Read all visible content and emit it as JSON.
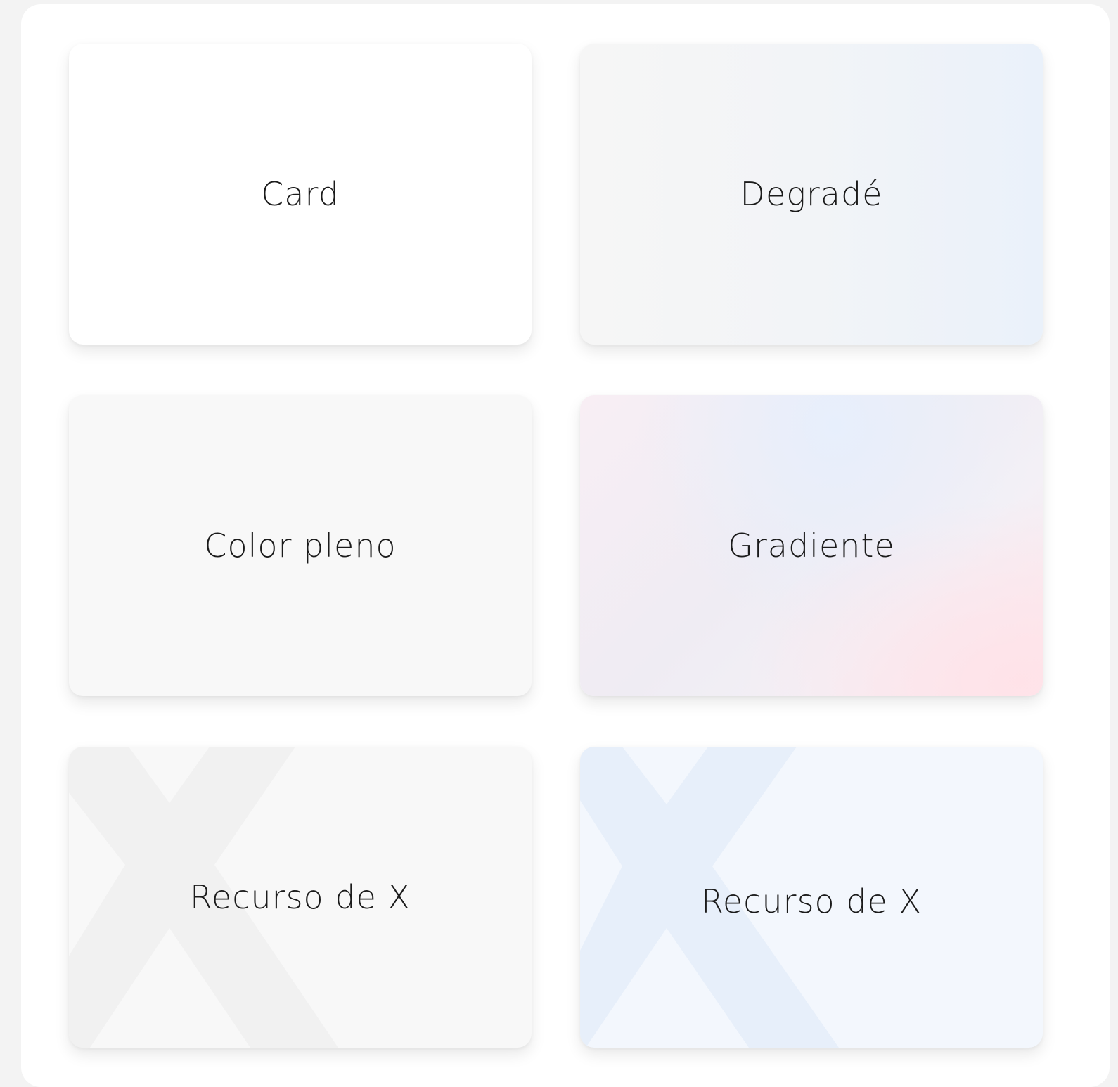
{
  "cards": [
    {
      "label": "Card"
    },
    {
      "label": "Degradé"
    },
    {
      "label": "Color pleno"
    },
    {
      "label": "Gradiente"
    },
    {
      "label": "Recurso de X"
    },
    {
      "label": "Recurso de X"
    }
  ],
  "colors": {
    "page_background": "#f3f3f3",
    "panel": "#ffffff",
    "solid_card": "#f8f8f8",
    "gradient_end_blue": "#eaf1fa",
    "gradient_pink": "#fde9ee",
    "x_mark_gray": "#f0f0f0",
    "x_mark_blue": "#e7effa",
    "text": "#1b1b1b"
  }
}
